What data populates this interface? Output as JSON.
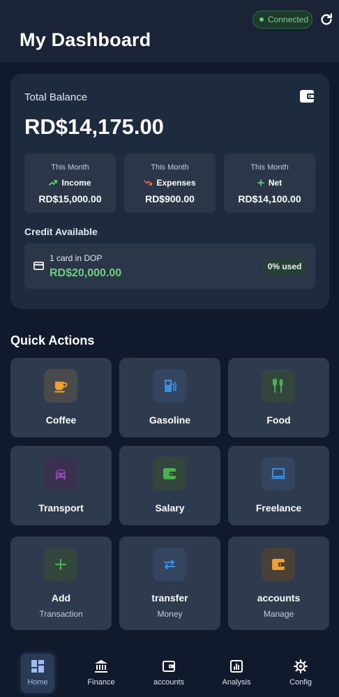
{
  "header": {
    "title": "My Dashboard",
    "status": "Connected"
  },
  "balance": {
    "label": "Total Balance",
    "amount": "RD$14,175.00",
    "stats": [
      {
        "period": "This Month",
        "kind": "Income",
        "value": "RD$15,000.00",
        "icon": "trending-up-icon",
        "color": "#5fd07a"
      },
      {
        "period": "This Month",
        "kind": "Expenses",
        "value": "RD$900.00",
        "icon": "trending-down-icon",
        "color": "#e8604f"
      },
      {
        "period": "This Month",
        "kind": "Net",
        "value": "RD$14,100.00",
        "icon": "plus-icon",
        "color": "#5fd07a"
      }
    ],
    "credit": {
      "label": "Credit Available",
      "cards": "1 card in DOP",
      "amount": "RD$20,000.00",
      "used": "0% used"
    }
  },
  "quick_actions": {
    "title": "Quick Actions",
    "items": [
      {
        "label": "Coffee",
        "sub": "",
        "icon": "coffee-icon",
        "color": "#f0a030"
      },
      {
        "label": "Gasoline",
        "sub": "",
        "icon": "gas-pump-icon",
        "color": "#3f8edc"
      },
      {
        "label": "Food",
        "sub": "",
        "icon": "cutlery-icon",
        "color": "#4caf50"
      },
      {
        "label": "Transport",
        "sub": "",
        "icon": "car-icon",
        "color": "#8e44ad"
      },
      {
        "label": "Salary",
        "sub": "",
        "icon": "wallet-icon",
        "color": "#4caf50"
      },
      {
        "label": "Freelance",
        "sub": "",
        "icon": "laptop-icon",
        "color": "#3f8edc"
      },
      {
        "label": "Add",
        "sub": "Transaction",
        "icon": "plus-icon",
        "color": "#4caf50"
      },
      {
        "label": "transfer",
        "sub": "Money",
        "icon": "transfer-icon",
        "color": "#3f8edc"
      },
      {
        "label": "accounts",
        "sub": "Manage",
        "icon": "wallet-icon",
        "color": "#f0a030"
      }
    ]
  },
  "nav": {
    "items": [
      {
        "label": "Home",
        "icon": "dashboard-icon",
        "active": true
      },
      {
        "label": "Finance",
        "icon": "bank-icon",
        "active": false
      },
      {
        "label": "accounts",
        "icon": "wallet-icon",
        "active": false
      },
      {
        "label": "Analysis",
        "icon": "chart-icon",
        "active": false
      },
      {
        "label": "Config",
        "icon": "gear-icon",
        "active": false
      }
    ]
  }
}
